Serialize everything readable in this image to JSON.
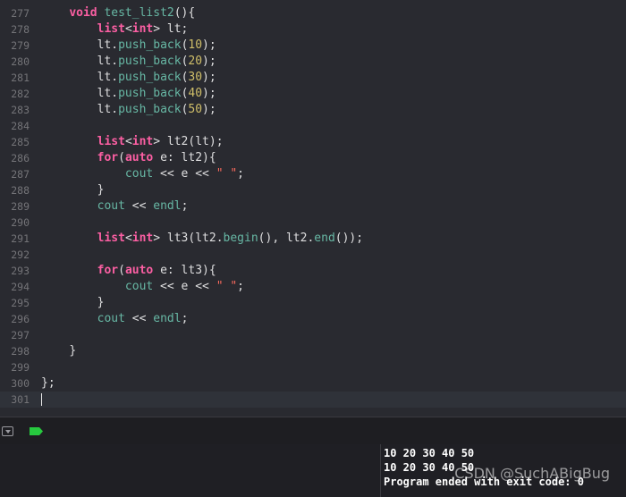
{
  "editor": {
    "lines": [
      {
        "n": "277",
        "indent": "    ",
        "tokens": [
          {
            "t": "void ",
            "c": "kw"
          },
          {
            "t": "test_list2",
            "c": "fn"
          },
          {
            "t": "(){",
            "c": "plain"
          }
        ]
      },
      {
        "n": "278",
        "indent": "        ",
        "tokens": [
          {
            "t": "list",
            "c": "kw"
          },
          {
            "t": "<",
            "c": "plain"
          },
          {
            "t": "int",
            "c": "kw"
          },
          {
            "t": "> lt;",
            "c": "plain"
          }
        ]
      },
      {
        "n": "279",
        "indent": "        ",
        "tokens": [
          {
            "t": "lt.",
            "c": "plain"
          },
          {
            "t": "push_back",
            "c": "fn"
          },
          {
            "t": "(",
            "c": "plain"
          },
          {
            "t": "10",
            "c": "num"
          },
          {
            "t": ");",
            "c": "plain"
          }
        ]
      },
      {
        "n": "280",
        "indent": "        ",
        "tokens": [
          {
            "t": "lt.",
            "c": "plain"
          },
          {
            "t": "push_back",
            "c": "fn"
          },
          {
            "t": "(",
            "c": "plain"
          },
          {
            "t": "20",
            "c": "num"
          },
          {
            "t": ");",
            "c": "plain"
          }
        ]
      },
      {
        "n": "281",
        "indent": "        ",
        "tokens": [
          {
            "t": "lt.",
            "c": "plain"
          },
          {
            "t": "push_back",
            "c": "fn"
          },
          {
            "t": "(",
            "c": "plain"
          },
          {
            "t": "30",
            "c": "num"
          },
          {
            "t": ");",
            "c": "plain"
          }
        ]
      },
      {
        "n": "282",
        "indent": "        ",
        "tokens": [
          {
            "t": "lt.",
            "c": "plain"
          },
          {
            "t": "push_back",
            "c": "fn"
          },
          {
            "t": "(",
            "c": "plain"
          },
          {
            "t": "40",
            "c": "num"
          },
          {
            "t": ");",
            "c": "plain"
          }
        ]
      },
      {
        "n": "283",
        "indent": "        ",
        "tokens": [
          {
            "t": "lt.",
            "c": "plain"
          },
          {
            "t": "push_back",
            "c": "fn"
          },
          {
            "t": "(",
            "c": "plain"
          },
          {
            "t": "50",
            "c": "num"
          },
          {
            "t": ");",
            "c": "plain"
          }
        ]
      },
      {
        "n": "284",
        "indent": "",
        "tokens": []
      },
      {
        "n": "285",
        "indent": "        ",
        "tokens": [
          {
            "t": "list",
            "c": "kw"
          },
          {
            "t": "<",
            "c": "plain"
          },
          {
            "t": "int",
            "c": "kw"
          },
          {
            "t": "> lt2(lt);",
            "c": "plain"
          }
        ]
      },
      {
        "n": "286",
        "indent": "        ",
        "tokens": [
          {
            "t": "for",
            "c": "kw"
          },
          {
            "t": "(",
            "c": "plain"
          },
          {
            "t": "auto",
            "c": "kw"
          },
          {
            "t": " e: lt2){",
            "c": "plain"
          }
        ]
      },
      {
        "n": "287",
        "indent": "            ",
        "tokens": [
          {
            "t": "cout",
            "c": "fn"
          },
          {
            "t": " << e << ",
            "c": "plain"
          },
          {
            "t": "\" \"",
            "c": "str"
          },
          {
            "t": ";",
            "c": "plain"
          }
        ]
      },
      {
        "n": "288",
        "indent": "        ",
        "tokens": [
          {
            "t": "}",
            "c": "plain"
          }
        ]
      },
      {
        "n": "289",
        "indent": "        ",
        "tokens": [
          {
            "t": "cout",
            "c": "fn"
          },
          {
            "t": " << ",
            "c": "plain"
          },
          {
            "t": "endl",
            "c": "fn"
          },
          {
            "t": ";",
            "c": "plain"
          }
        ]
      },
      {
        "n": "290",
        "indent": "",
        "tokens": []
      },
      {
        "n": "291",
        "indent": "        ",
        "tokens": [
          {
            "t": "list",
            "c": "kw"
          },
          {
            "t": "<",
            "c": "plain"
          },
          {
            "t": "int",
            "c": "kw"
          },
          {
            "t": "> lt3(lt2.",
            "c": "plain"
          },
          {
            "t": "begin",
            "c": "fn"
          },
          {
            "t": "(), lt2.",
            "c": "plain"
          },
          {
            "t": "end",
            "c": "fn"
          },
          {
            "t": "());",
            "c": "plain"
          }
        ]
      },
      {
        "n": "292",
        "indent": "",
        "tokens": []
      },
      {
        "n": "293",
        "indent": "        ",
        "tokens": [
          {
            "t": "for",
            "c": "kw"
          },
          {
            "t": "(",
            "c": "plain"
          },
          {
            "t": "auto",
            "c": "kw"
          },
          {
            "t": " e: lt3){",
            "c": "plain"
          }
        ]
      },
      {
        "n": "294",
        "indent": "            ",
        "tokens": [
          {
            "t": "cout",
            "c": "fn"
          },
          {
            "t": " << e << ",
            "c": "plain"
          },
          {
            "t": "\" \"",
            "c": "str"
          },
          {
            "t": ";",
            "c": "plain"
          }
        ]
      },
      {
        "n": "295",
        "indent": "        ",
        "tokens": [
          {
            "t": "}",
            "c": "plain"
          }
        ]
      },
      {
        "n": "296",
        "indent": "        ",
        "tokens": [
          {
            "t": "cout",
            "c": "fn"
          },
          {
            "t": " << ",
            "c": "plain"
          },
          {
            "t": "endl",
            "c": "fn"
          },
          {
            "t": ";",
            "c": "plain"
          }
        ]
      },
      {
        "n": "297",
        "indent": "",
        "tokens": []
      },
      {
        "n": "298",
        "indent": "    ",
        "tokens": [
          {
            "t": "}",
            "c": "plain"
          }
        ]
      },
      {
        "n": "299",
        "indent": "",
        "tokens": []
      },
      {
        "n": "300",
        "indent": "",
        "tokens": [
          {
            "t": "};",
            "c": "plain"
          }
        ]
      },
      {
        "n": "301",
        "indent": "",
        "tokens": [],
        "current": true
      }
    ]
  },
  "debug_bar": {
    "toggle_icon": "hide-debug-area-icon",
    "breakpoint_icon": "breakpoints-active-icon",
    "breakpoint_color": "#27c93f"
  },
  "console": {
    "output": [
      "10 20 30 40 50",
      "10 20 30 40 50",
      "Program ended with exit code: 0"
    ],
    "watermark": "CSDN @SuchABigBug"
  },
  "colors": {
    "keyword": "#fc5fa3",
    "function": "#67b7a4",
    "number": "#d0bf69",
    "string": "#fc6a5d",
    "text": "#dfdfe0",
    "editor_bg": "#292a30"
  }
}
